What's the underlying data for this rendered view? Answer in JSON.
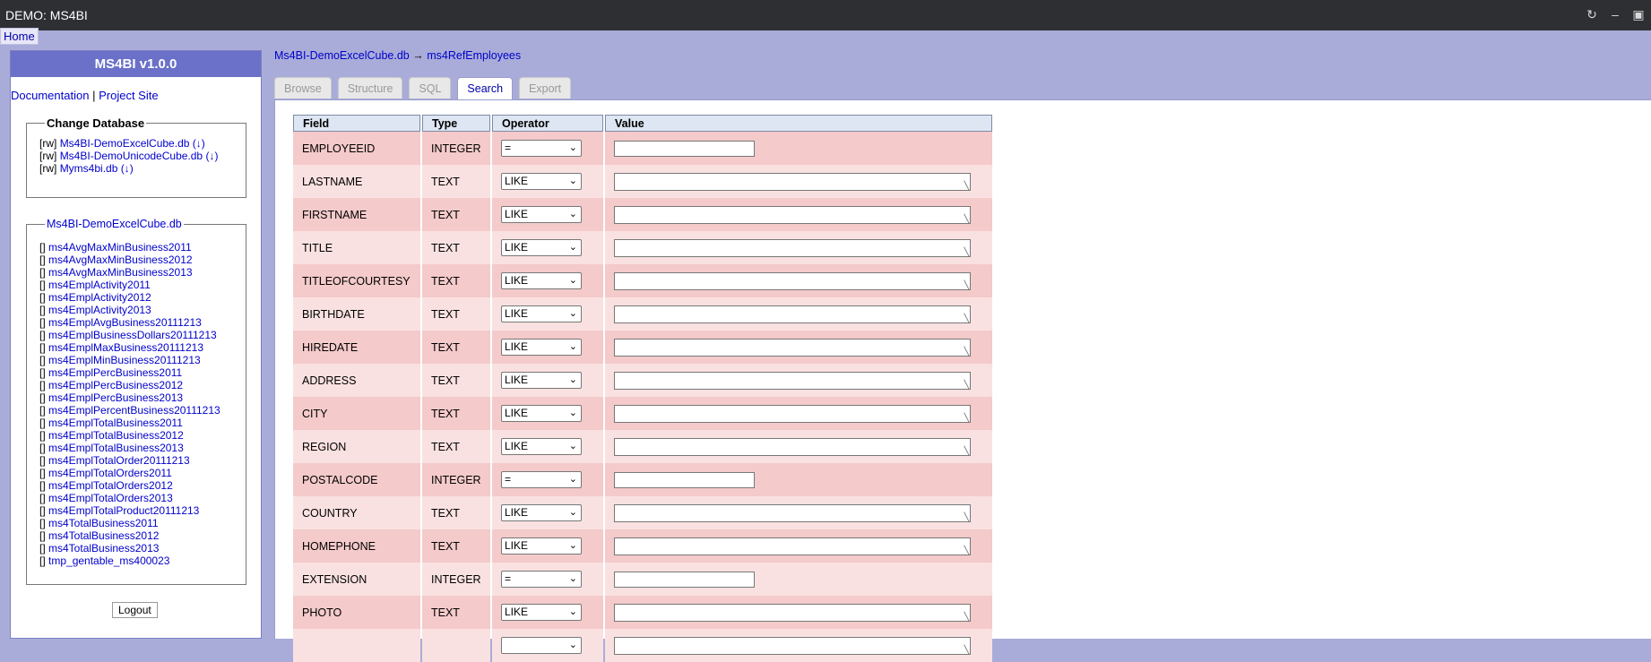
{
  "window": {
    "title": "DEMO: MS4BI"
  },
  "nav": {
    "home": "Home"
  },
  "sidebar": {
    "title": "MS4BI v1.0.0",
    "documentation": "Documentation",
    "separator": "|",
    "project_site": "Project Site",
    "change_db": {
      "legend": "Change Database",
      "items": [
        {
          "mode": "[rw]",
          "name": "Ms4BI-DemoExcelCube.db",
          "dl": "(↓)"
        },
        {
          "mode": "[rw]",
          "name": "Ms4BI-DemoUnicodeCube.db",
          "dl": "(↓)"
        },
        {
          "mode": "[rw]",
          "name": "Myms4bi.db",
          "dl": "(↓)"
        }
      ]
    },
    "tables": {
      "legend": "Ms4BI-DemoExcelCube.db",
      "items": [
        "ms4AvgMaxMinBusiness2011",
        "ms4AvgMaxMinBusiness2012",
        "ms4AvgMaxMinBusiness2013",
        "ms4EmplActivity2011",
        "ms4EmplActivity2012",
        "ms4EmplActivity2013",
        "ms4EmplAvgBusiness20111213",
        "ms4EmplBusinessDollars20111213",
        "ms4EmplMaxBusiness20111213",
        "ms4EmplMinBusiness20111213",
        "ms4EmplPercBusiness2011",
        "ms4EmplPercBusiness2012",
        "ms4EmplPercBusiness2013",
        "ms4EmplPercentBusiness20111213",
        "ms4EmplTotalBusiness2011",
        "ms4EmplTotalBusiness2012",
        "ms4EmplTotalBusiness2013",
        "ms4EmplTotalOrder20111213",
        "ms4EmplTotalOrders2011",
        "ms4EmplTotalOrders2012",
        "ms4EmplTotalOrders2013",
        "ms4EmplTotalProduct20111213",
        "ms4TotalBusiness2011",
        "ms4TotalBusiness2012",
        "ms4TotalBusiness2013",
        "tmp_gentable_ms400023"
      ],
      "bracket": "[]"
    },
    "logout": "Logout"
  },
  "breadcrumb": {
    "db": "Ms4BI-DemoExcelCube.db",
    "arrow": "→",
    "table": "ms4RefEmployees"
  },
  "tabs": [
    {
      "label": "Browse",
      "active": false
    },
    {
      "label": "Structure",
      "active": false
    },
    {
      "label": "SQL",
      "active": false
    },
    {
      "label": "Search",
      "active": true
    },
    {
      "label": "Export",
      "active": false
    }
  ],
  "search": {
    "headers": {
      "field": "Field",
      "type": "Type",
      "operator": "Operator",
      "value": "Value"
    },
    "rows": [
      {
        "field": "EMPLOYEEID",
        "type": "INTEGER",
        "op": "=",
        "input": "text"
      },
      {
        "field": "LASTNAME",
        "type": "TEXT",
        "op": "LIKE",
        "input": "textarea"
      },
      {
        "field": "FIRSTNAME",
        "type": "TEXT",
        "op": "LIKE",
        "input": "textarea"
      },
      {
        "field": "TITLE",
        "type": "TEXT",
        "op": "LIKE",
        "input": "textarea"
      },
      {
        "field": "TITLEOFCOURTESY",
        "type": "TEXT",
        "op": "LIKE",
        "input": "textarea"
      },
      {
        "field": "BIRTHDATE",
        "type": "TEXT",
        "op": "LIKE",
        "input": "textarea"
      },
      {
        "field": "HIREDATE",
        "type": "TEXT",
        "op": "LIKE",
        "input": "textarea"
      },
      {
        "field": "ADDRESS",
        "type": "TEXT",
        "op": "LIKE",
        "input": "textarea"
      },
      {
        "field": "CITY",
        "type": "TEXT",
        "op": "LIKE",
        "input": "textarea"
      },
      {
        "field": "REGION",
        "type": "TEXT",
        "op": "LIKE",
        "input": "textarea"
      },
      {
        "field": "POSTALCODE",
        "type": "INTEGER",
        "op": "=",
        "input": "text"
      },
      {
        "field": "COUNTRY",
        "type": "TEXT",
        "op": "LIKE",
        "input": "textarea"
      },
      {
        "field": "HOMEPHONE",
        "type": "TEXT",
        "op": "LIKE",
        "input": "textarea"
      },
      {
        "field": "EXTENSION",
        "type": "INTEGER",
        "op": "=",
        "input": "text"
      },
      {
        "field": "PHOTO",
        "type": "TEXT",
        "op": "LIKE",
        "input": "textarea"
      },
      {
        "field": "",
        "type": "",
        "op": "",
        "input": "textarea"
      }
    ]
  },
  "icons": {
    "refresh": "refresh-icon",
    "minimize": "minimize-icon",
    "maximize": "maximize-icon"
  }
}
